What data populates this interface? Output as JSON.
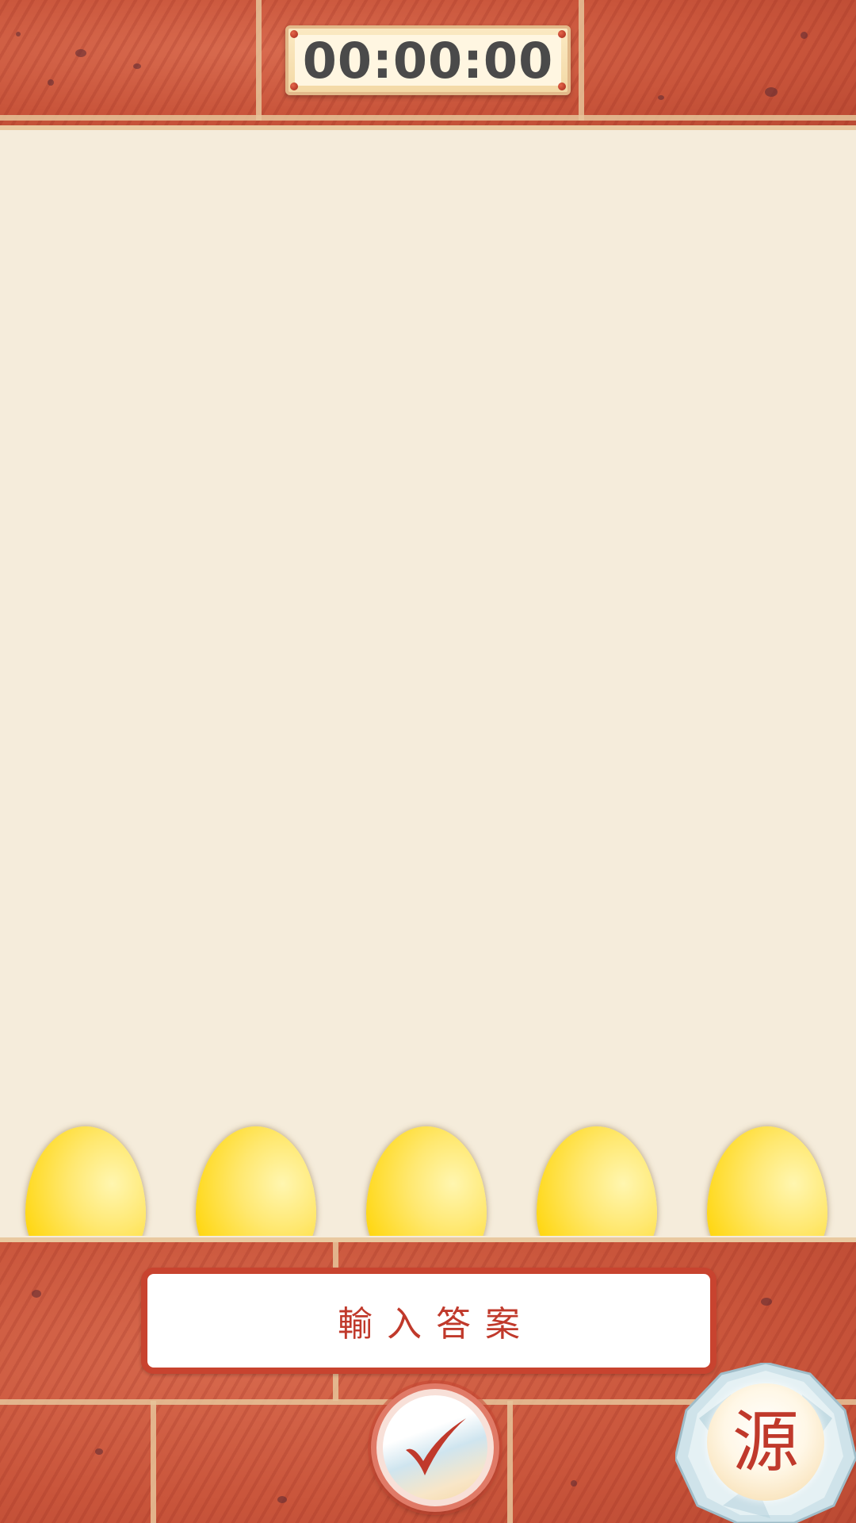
{
  "timer": {
    "display": "00:00:00"
  },
  "eggs": {
    "count": 5
  },
  "answer_input": {
    "placeholder": "輸入答案"
  },
  "submit_button": {
    "icon": "checkmark-icon"
  },
  "source_button": {
    "label": "源"
  },
  "colors": {
    "brick": "#c9553b",
    "mortar": "#e6c49a",
    "background": "#f5ecdb",
    "accent_red": "#c0392b",
    "egg_yellow": "#ffd818",
    "timer_text": "#4a4a4a"
  }
}
